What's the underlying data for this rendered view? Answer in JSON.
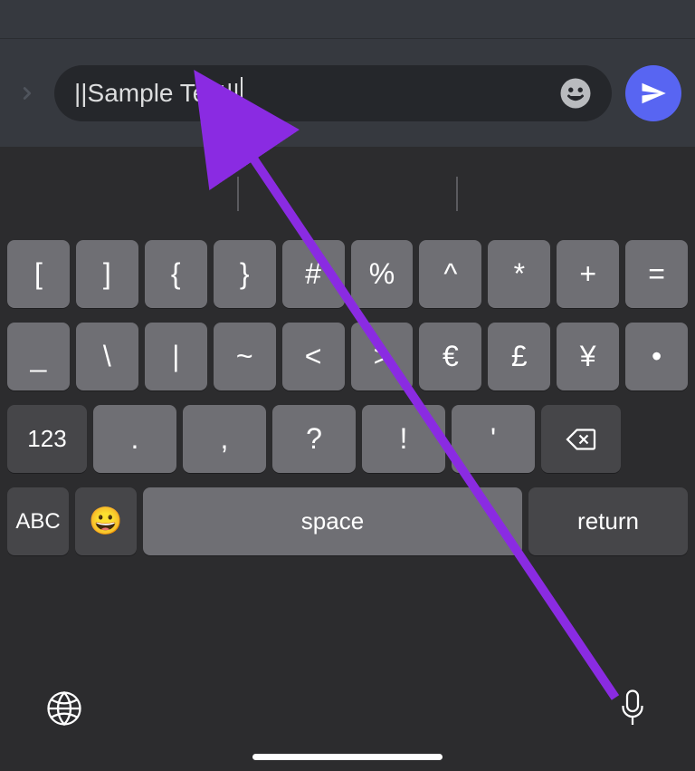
{
  "input": {
    "text": "||Sample Text||"
  },
  "keyboard": {
    "row1": [
      "[",
      "]",
      "{",
      "}",
      "#",
      "%",
      "^",
      "*",
      "+",
      "="
    ],
    "row2": [
      "_",
      "\\",
      "|",
      "~",
      "<",
      ">",
      "€",
      "£",
      "¥",
      "•"
    ],
    "row3_numbers": "123",
    "row3_punc": [
      ".",
      ",",
      "?",
      "!",
      "'"
    ],
    "row4_abc": "ABC",
    "row4_emoji": "😀",
    "row4_space": "space",
    "row4_return": "return"
  }
}
